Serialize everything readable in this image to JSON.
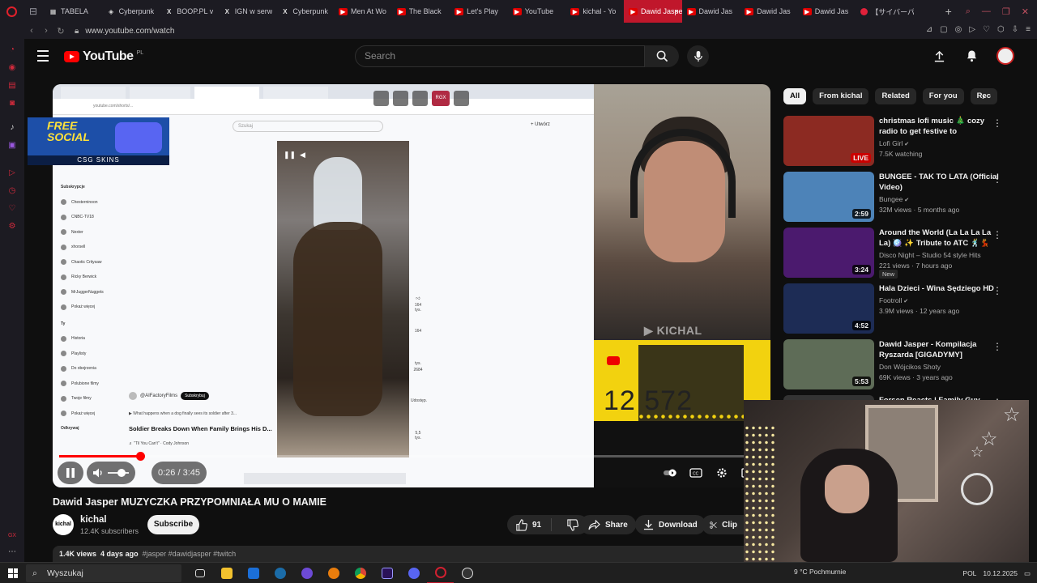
{
  "browser": {
    "tabs": [
      {
        "label": "TABELA",
        "icon": "tabela-icon"
      },
      {
        "label": "Cyberpunk",
        "icon": "cyberpunk-icon"
      },
      {
        "label": "BOOP.PL v",
        "icon": "x-icon"
      },
      {
        "label": "IGN w serw",
        "icon": "x-icon"
      },
      {
        "label": "Cyberpunk",
        "icon": "x-icon"
      },
      {
        "label": "Men At Wo",
        "icon": "youtube-icon"
      },
      {
        "label": "The Black",
        "icon": "youtube-icon"
      },
      {
        "label": "Let's Play",
        "icon": "youtube-icon"
      },
      {
        "label": "YouTube",
        "icon": "youtube-icon"
      },
      {
        "label": "kichal - Yo",
        "icon": "youtube-icon"
      },
      {
        "label": "Dawid Jasper M",
        "icon": "youtube-icon",
        "active": true
      },
      {
        "label": "Dawid Jas",
        "icon": "youtube-icon"
      },
      {
        "label": "Dawid Jas",
        "icon": "youtube-icon"
      },
      {
        "label": "Dawid Jas",
        "icon": "youtube-icon"
      },
      {
        "label": "【サイバーパ",
        "icon": "jp-icon"
      }
    ],
    "url": "www.youtube.com/watch"
  },
  "youtube": {
    "logo_text": "YouTube",
    "logo_country": "PL",
    "search_placeholder": "Search"
  },
  "player": {
    "inner_url": "youtube.com/shorts/...",
    "inner_search": "Szukaj",
    "inner_create": "+ Utwórz",
    "inner_menu_heading": "Subskrypcje",
    "inner_menu": [
      "Chesterninoon",
      "CNBC-TV18",
      "Nexter",
      "xhorsell",
      "Chaotic Critysaw",
      "Ricky Berwick",
      "MrJuggerNuggets",
      "Pokaż więcej"
    ],
    "inner_you": "Ty",
    "inner_you_items": [
      "Historia",
      "Playlisty",
      "Do obejrzenia",
      "Polubione filmy",
      "Twoje filmy",
      "Pokaż więcej"
    ],
    "inner_explore": "Odkrywaj",
    "inner_channel": "@AIFactoryFilms",
    "inner_subscribe": "Subskrybuj",
    "inner_desc": "▶ What happens when a dog finally sees its soldier after 3...",
    "inner_title": "Soldier Breaks Down When Family Brings His D...",
    "inner_music": "♬ \"Til You Can't\" · Cody Johnson",
    "inner_likes": "164 tys.",
    "inner_comments": "2684",
    "inner_share": "Udostęp.",
    "inner_remix": "5,5 tys.",
    "watermark": "KICHAL",
    "counter": "12 572",
    "promo_line1": "FREE",
    "promo_line2": "SOCIAL",
    "promo_footer": "CSG SKINS",
    "ext_label": "RGX",
    "time": "0:26 / 3:45",
    "progress": 0.115
  },
  "video": {
    "title": "Dawid Jasper MUZYCZKA PRZYPOMNIAŁA MU O MAMIE",
    "channel": "kichal",
    "channel_avatar": "kichal",
    "subscribers": "12.4K subscribers",
    "subscribe": "Subscribe",
    "likes": "91",
    "share": "Share",
    "download": "Download",
    "clip": "Clip",
    "views": "1.4K views",
    "age": "4 days ago",
    "hashtags": "#jasper #dawidjasper #twitch"
  },
  "chips": [
    "All",
    "From kichal",
    "Related",
    "For you",
    "Rec"
  ],
  "recommendations": [
    {
      "title": "christmas lofi music 🎄 cozy radio to get festive to",
      "channel": "Lofi Girl",
      "verified": true,
      "views": "7.5K watching",
      "badge": "LIVE",
      "thumb": "#8c2a22"
    },
    {
      "title": "BUNGEE - TAK TO LATA (Official Video)",
      "channel": "Bungee",
      "verified": true,
      "views": "32M views · 5 months ago",
      "badge": "2:59",
      "thumb": "#4d83b8"
    },
    {
      "title": "Around the World (La La La La La) 🪩 ✨ Tribute to ATC 🕺💃",
      "channel": "Disco Night – Studio 54 style Hits",
      "verified": false,
      "views": "221 views · 7 hours ago",
      "badge": "3:24",
      "new": "New",
      "thumb": "#4b1a6e"
    },
    {
      "title": "Hala Dzieci - Wina Sędziego HD",
      "channel": "Footroll",
      "verified": true,
      "views": "3.9M views · 12 years ago",
      "badge": "4:52",
      "thumb": "#1d2c55"
    },
    {
      "title": "Dawid Jasper - Kompilacja Ryszarda [GIGADYMY]",
      "channel": "Don Wójcikos Shoty",
      "verified": false,
      "views": "69K views · 3 years ago",
      "badge": "5:53",
      "thumb": "#5e6c57"
    },
    {
      "title": "Forsen Reacts | Family Guy",
      "channel": "",
      "verified": false,
      "views": "",
      "badge": "",
      "thumb": "#333"
    }
  ],
  "taskbar": {
    "search": "Wyszukaj",
    "weather": "9 °C  Pochmurnie",
    "lang": "POL",
    "date": "10.12.2025"
  },
  "colors": {
    "accent": "#ff0000",
    "tab_active": "#c0172b",
    "bg": "#0f0f0f"
  }
}
